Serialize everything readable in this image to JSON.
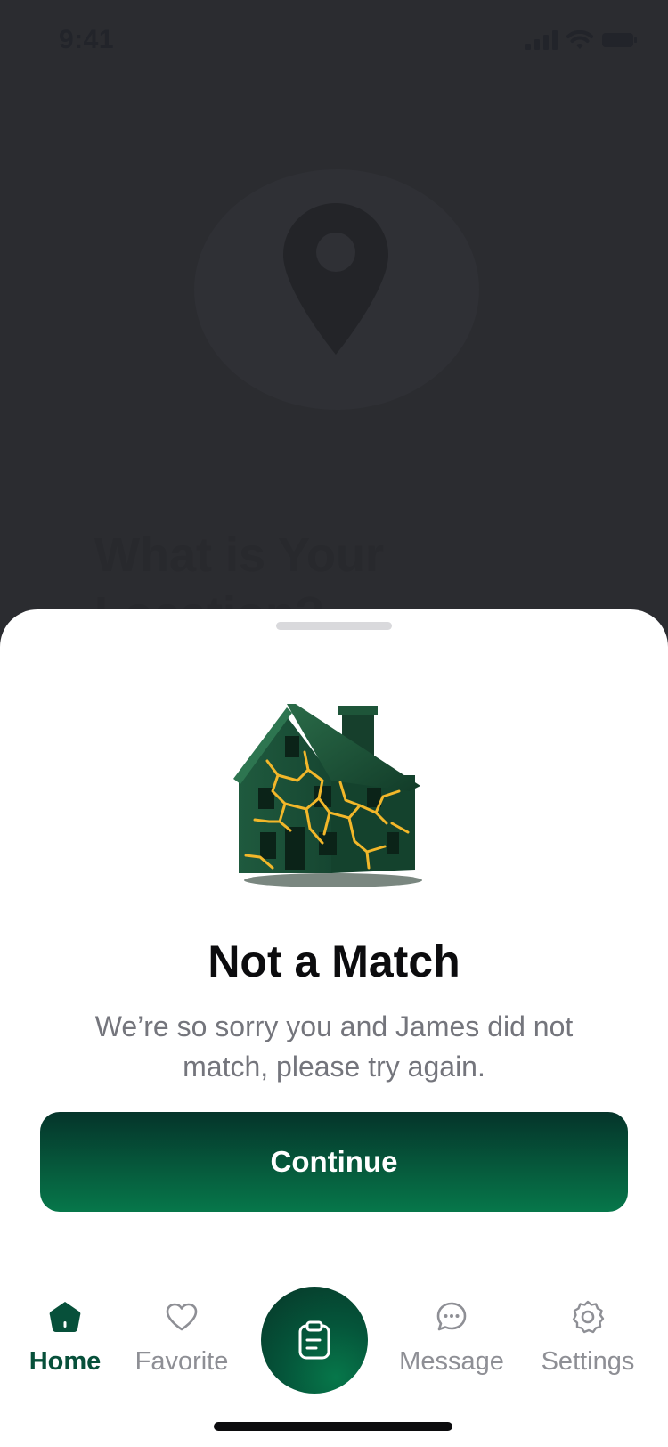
{
  "status_bar": {
    "time": "9:41"
  },
  "background": {
    "title": "What is Your\nLocation?"
  },
  "sheet": {
    "title": "Not a Match",
    "description": "We’re so sorry you and James did not match, please try again.",
    "continue_label": "Continue"
  },
  "nav": {
    "home_label": "Home",
    "favorite_label": "Favorite",
    "message_label": "Message",
    "settings_label": "Settings",
    "active": "Home"
  },
  "colors": {
    "brand_dark": "#05342a",
    "brand": "#06774a",
    "active_nav": "#07503a",
    "inactive_nav": "#8e8f95"
  }
}
